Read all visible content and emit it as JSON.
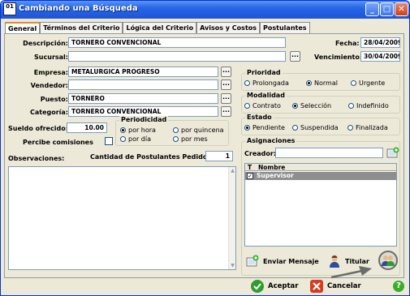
{
  "window": {
    "title": "Cambiando una Búsqueda",
    "icon_label": "01"
  },
  "tabs": [
    "General",
    "Términos del Criterio",
    "Lógica del Criterio",
    "Avisos y Costos",
    "Postulantes"
  ],
  "form": {
    "descripcion_label": "Descripción:",
    "descripcion_value": "TORNERO CONVENCIONAL",
    "sucursal_label": "Sucursal:",
    "sucursal_value": "",
    "empresa_label": "Empresa:",
    "empresa_value": "METALURGICA PROGRESO",
    "vendedor_label": "Vendedor:",
    "vendedor_value": "",
    "puesto_label": "Puesto:",
    "puesto_value": "TORNERO",
    "categoria_label": "Categoría:",
    "categoria_value": "TORNERO CONVENCIONAL",
    "fecha_label": "Fecha:",
    "fecha_value": "28/04/2009",
    "vencimiento_label": "Vencimiento:",
    "vencimiento_value": "30/04/2009",
    "sueldo_label": "Sueldo ofrecido:",
    "sueldo_value": "10.00",
    "comisiones_label": "Percibe comisiones",
    "observaciones_label": "Observaciones:",
    "cantidad_label": "Cantidad de Postulantes Pedidos:",
    "cantidad_value": "1",
    "dots": "..."
  },
  "periodicidad": {
    "title": "Periodicidad",
    "options": [
      "por hora",
      "por quincena",
      "por día",
      "por mes"
    ],
    "selected": "por hora"
  },
  "prioridad": {
    "title": "Prioridad",
    "options": [
      "Prolongada",
      "Normal",
      "Urgente"
    ],
    "selected": "Normal"
  },
  "modalidad": {
    "title": "Modalidad",
    "options": [
      "Contrato",
      "Selección",
      "Indefinido"
    ],
    "selected": "Selección"
  },
  "estado": {
    "title": "Estado",
    "options": [
      "Pendiente",
      "Suspendida",
      "Finalizada"
    ],
    "selected": "Pendiente"
  },
  "asignaciones": {
    "title": "Asignaciones",
    "creador_label": "Creador:",
    "creador_value": "",
    "columns": [
      "T",
      "Nombre"
    ],
    "rows": [
      {
        "checked": true,
        "nombre": "Supervisor"
      }
    ],
    "enviar_label": "Enviar Mensaje",
    "titular_label": "Titular"
  },
  "footer": {
    "aceptar_label": "Aceptar",
    "cancelar_label": "Cancelar"
  },
  "colors": {
    "titlebar": "#2566e8",
    "selected_row": "#8e8e8e",
    "accept_green": "#2e9e2e",
    "cancel_red": "#d93a20"
  }
}
